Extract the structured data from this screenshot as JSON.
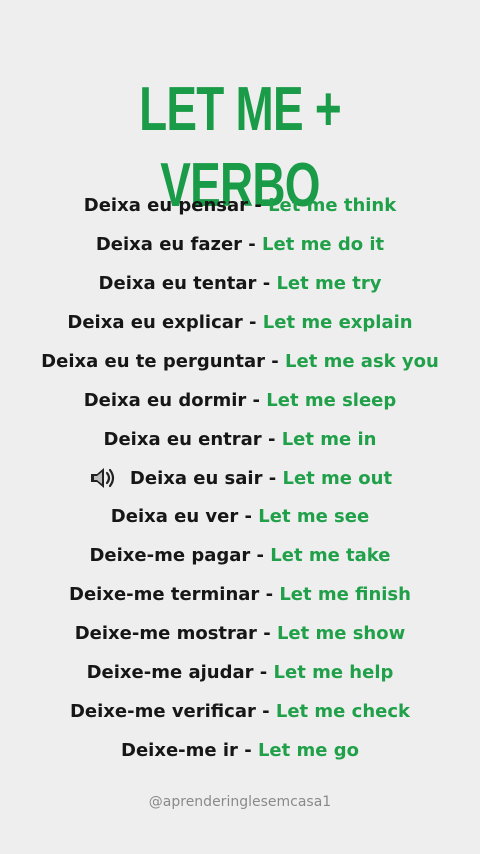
{
  "title": "LET ME + VERBO",
  "rows": [
    {
      "pt": "Deixa eu pensar",
      "en": "Let me think"
    },
    {
      "pt": "Deixa eu fazer",
      "en": "Let me do it"
    },
    {
      "pt": "Deixa eu tentar",
      "en": "Let me try"
    },
    {
      "pt": "Deixa eu explicar",
      "en": "Let me explain"
    },
    {
      "pt": "Deixa eu te perguntar",
      "en": "Let me ask you"
    },
    {
      "pt": "Deixa eu dormir",
      "en": "Let me sleep"
    },
    {
      "pt": "Deixa eu entrar",
      "en": "Let me in"
    },
    {
      "pt": "Deixa eu sair",
      "en": "Let me out"
    },
    {
      "pt": "Deixa eu ver",
      "en": "Let me see"
    },
    {
      "pt": "Deixe-me pagar",
      "en": "Let me take"
    },
    {
      "pt": "Deixe-me terminar",
      "en": "Let me finish"
    },
    {
      "pt": "Deixe-me mostrar",
      "en": "Let me show"
    },
    {
      "pt": "Deixe-me ajudar",
      "en": "Let me help"
    },
    {
      "pt": "Deixe-me verificar",
      "en": "Let me check"
    },
    {
      "pt": "Deixe-me ir",
      "en": "Let me go"
    }
  ],
  "separator": " - ",
  "speaker_row": 7,
  "speaker_icon": "speaker-icon",
  "handle": "@aprenderinglesemcasa1",
  "colors": {
    "background": "#eeeeee",
    "accent": "#1a9b47",
    "text": "#161616",
    "handle": "#8a8a8a"
  }
}
